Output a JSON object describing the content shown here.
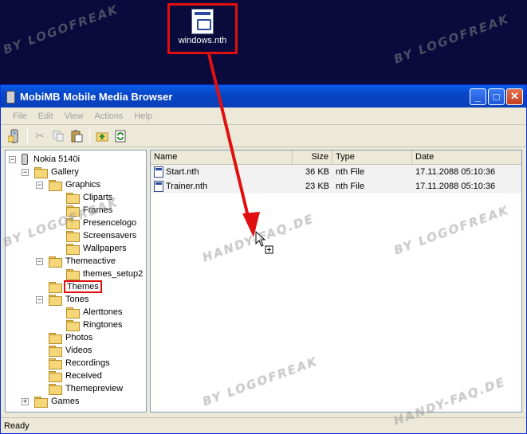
{
  "desktop": {
    "file_label": "windows.nth"
  },
  "window": {
    "title": "MobiMB Mobile Media Browser",
    "buttons": {
      "minimize": "_",
      "maximize": "□",
      "close": "✕"
    }
  },
  "menu": [
    "File",
    "Edit",
    "View",
    "Actions",
    "Help"
  ],
  "tree": {
    "root": "Nokia 5140i",
    "gallery": "Gallery",
    "graphics": "Graphics",
    "cliparts": "Cliparts",
    "frames": "Frames",
    "presencelogo": "Presencelogo",
    "screensavers": "Screensavers",
    "wallpapers": "Wallpapers",
    "themeactive": "Themeactive",
    "themes_setup2": "themes_setup2",
    "themes": "Themes",
    "tones": "Tones",
    "alerttones": "Alerttones",
    "ringtones": "Ringtones",
    "photos": "Photos",
    "videos": "Videos",
    "recordings": "Recordings",
    "received": "Received",
    "themepreview": "Themepreview",
    "games": "Games"
  },
  "list": {
    "columns": [
      "Name",
      "Size",
      "Type",
      "Date"
    ],
    "rows": [
      {
        "name": "Start.nth",
        "size": "36 KB",
        "type": "nth File",
        "date": "17.11.2088 05:10:36"
      },
      {
        "name": "Trainer.nth",
        "size": "23 KB",
        "type": "nth File",
        "date": "17.11.2088 05:10:36"
      }
    ]
  },
  "status": "Ready",
  "watermark": {
    "line1": "BY LOGOFREAK",
    "line2": "HANDY-FAQ.DE"
  },
  "colors": {
    "highlight": "#e01010",
    "titlebar": "#0a5ee8",
    "desktop": "#0a0a3c"
  },
  "icons": [
    "windows-file-icon",
    "app-icon",
    "minimize-icon",
    "maximize-icon",
    "close-icon",
    "phone-icon",
    "folder-icon",
    "cut-icon",
    "copy-icon",
    "paste-icon",
    "up-folder-icon",
    "refresh-icon",
    "drag-cursor-icon"
  ]
}
